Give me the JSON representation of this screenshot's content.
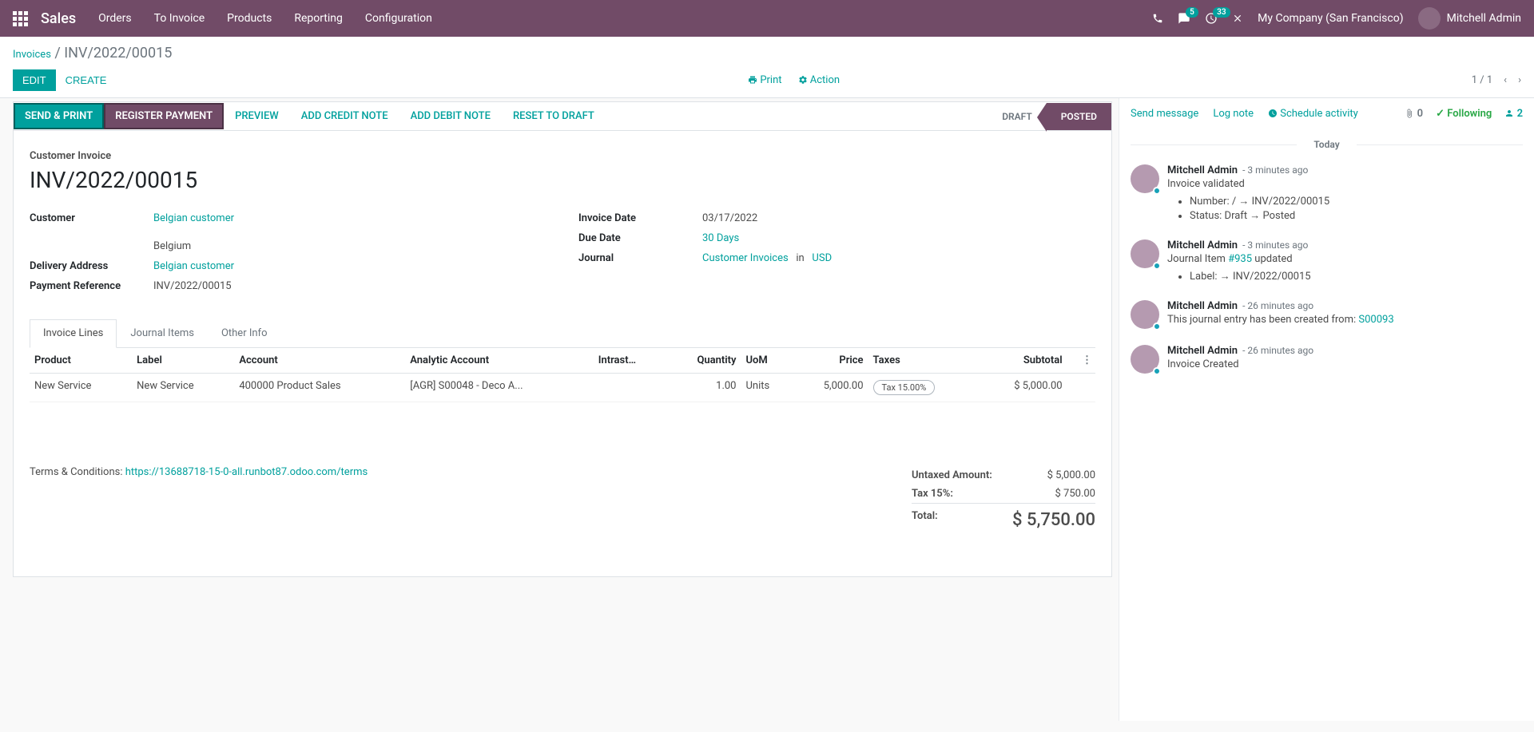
{
  "topnav": {
    "brand": "Sales",
    "menu": [
      "Orders",
      "To Invoice",
      "Products",
      "Reporting",
      "Configuration"
    ],
    "msg_badge": "5",
    "activity_badge": "33",
    "company": "My Company (San Francisco)",
    "user": "Mitchell Admin"
  },
  "breadcrumb": {
    "root": "Invoices",
    "current": "INV/2022/00015"
  },
  "toolbar": {
    "edit": "EDIT",
    "create": "CREATE",
    "print": "Print",
    "action": "Action",
    "pager": "1 / 1"
  },
  "statusbar": {
    "buttons": [
      "SEND & PRINT",
      "REGISTER PAYMENT",
      "PREVIEW",
      "ADD CREDIT NOTE",
      "ADD DEBIT NOTE",
      "RESET TO DRAFT"
    ],
    "stages": {
      "draft": "DRAFT",
      "posted": "POSTED"
    }
  },
  "form": {
    "subtitle": "Customer Invoice",
    "title": "INV/2022/00015",
    "left": {
      "customer_label": "Customer",
      "customer": "Belgian customer",
      "country": "Belgium",
      "delivery_label": "Delivery Address",
      "delivery": "Belgian customer",
      "payref_label": "Payment Reference",
      "payref": "INV/2022/00015"
    },
    "right": {
      "invdate_label": "Invoice Date",
      "invdate": "03/17/2022",
      "duedate_label": "Due Date",
      "duedate": "30 Days",
      "journal_label": "Journal",
      "journal": "Customer Invoices",
      "in": "in",
      "currency": "USD"
    }
  },
  "tabs": [
    "Invoice Lines",
    "Journal Items",
    "Other Info"
  ],
  "table": {
    "headers": [
      "Product",
      "Label",
      "Account",
      "Analytic Account",
      "Intrast…",
      "Quantity",
      "UoM",
      "Price",
      "Taxes",
      "Subtotal"
    ],
    "row": {
      "product": "New Service",
      "label": "New Service",
      "account": "400000 Product Sales",
      "analytic": "[AGR] S00048 - Deco A...",
      "intrastat": "",
      "qty": "1.00",
      "uom": "Units",
      "price": "5,000.00",
      "tax": "Tax 15.00%",
      "subtotal": "$ 5,000.00"
    }
  },
  "terms": {
    "prefix": "Terms & Conditions: ",
    "url": "https://13688718-15-0-all.runbot87.odoo.com/terms"
  },
  "totals": {
    "untaxed_label": "Untaxed Amount:",
    "untaxed": "$ 5,000.00",
    "tax_label": "Tax 15%:",
    "tax": "$ 750.00",
    "total_label": "Total:",
    "total": "$ 5,750.00"
  },
  "chatter": {
    "send": "Send message",
    "lognote": "Log note",
    "schedule": "Schedule activity",
    "attach_count": "0",
    "following": "Following",
    "follower_count": "2",
    "today": "Today",
    "messages": [
      {
        "name": "Mitchell Admin",
        "time": "- 3 minutes ago",
        "text": "Invoice validated",
        "bullets": [
          "Number: / → INV/2022/00015",
          "Status: Draft → Posted"
        ]
      },
      {
        "name": "Mitchell Admin",
        "time": "- 3 minutes ago",
        "text_prefix": "Journal Item ",
        "text_link": "#935",
        "text_suffix": " updated",
        "bullets": [
          "Label: → INV/2022/00015"
        ]
      },
      {
        "name": "Mitchell Admin",
        "time": "- 26 minutes ago",
        "text_prefix": "This journal entry has been created from: ",
        "text_link": "S00093"
      },
      {
        "name": "Mitchell Admin",
        "time": "- 26 minutes ago",
        "text": "Invoice Created"
      }
    ]
  }
}
